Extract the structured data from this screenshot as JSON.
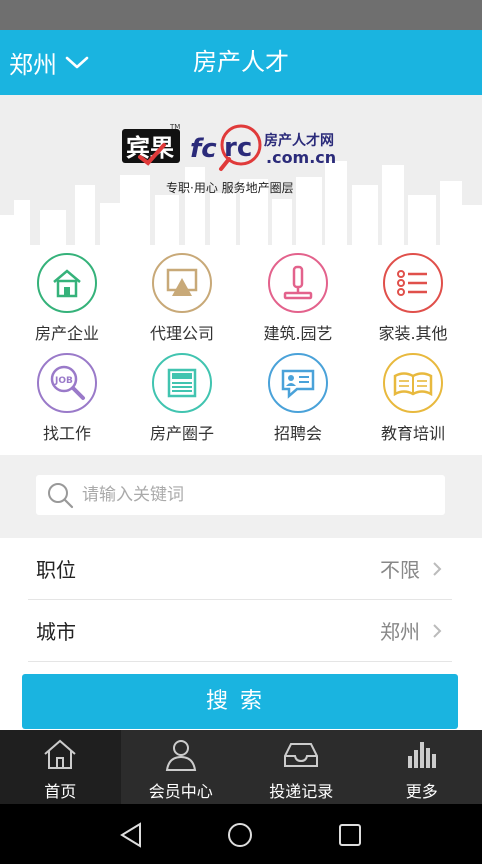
{
  "header": {
    "city": "郑州",
    "title": "房产人才"
  },
  "banner": {
    "brand_cn": "宾果",
    "brand_tm": "TM",
    "logo_fc": "fc",
    "logo_rc": "rc",
    "site_name_cn": "房产人才网",
    "site_domain": ".com.cn",
    "slogan": "专职·用心  服务地产圈层"
  },
  "categories": [
    {
      "label": "房产企业",
      "icon": "house-icon",
      "color": "#35b27a"
    },
    {
      "label": "代理公司",
      "icon": "easel-icon",
      "color": "#c8a978"
    },
    {
      "label": "建筑.园艺",
      "icon": "roller-icon",
      "color": "#e3628c"
    },
    {
      "label": "家装.其他",
      "icon": "list-icon",
      "color": "#e0504b"
    },
    {
      "label": "找工作",
      "icon": "job-search-icon",
      "color": "#9a7ac9"
    },
    {
      "label": "房产圈子",
      "icon": "newspaper-icon",
      "color": "#41c4b0"
    },
    {
      "label": "招聘会",
      "icon": "id-card-icon",
      "color": "#4aa2d9"
    },
    {
      "label": "教育培训",
      "icon": "book-icon",
      "color": "#e8b93e"
    }
  ],
  "search": {
    "placeholder": "请输入关键词"
  },
  "filters": {
    "position_label": "职位",
    "position_value": "不限",
    "city_label": "城市",
    "city_value": "郑州"
  },
  "search_button": "搜索",
  "tabs": [
    {
      "label": "首页",
      "icon": "home-icon"
    },
    {
      "label": "会员中心",
      "icon": "user-icon"
    },
    {
      "label": "投递记录",
      "icon": "inbox-icon"
    },
    {
      "label": "更多",
      "icon": "bars-icon"
    }
  ],
  "colors": {
    "accent": "#1ab4e0",
    "tabbar": "#2c2c2c"
  }
}
